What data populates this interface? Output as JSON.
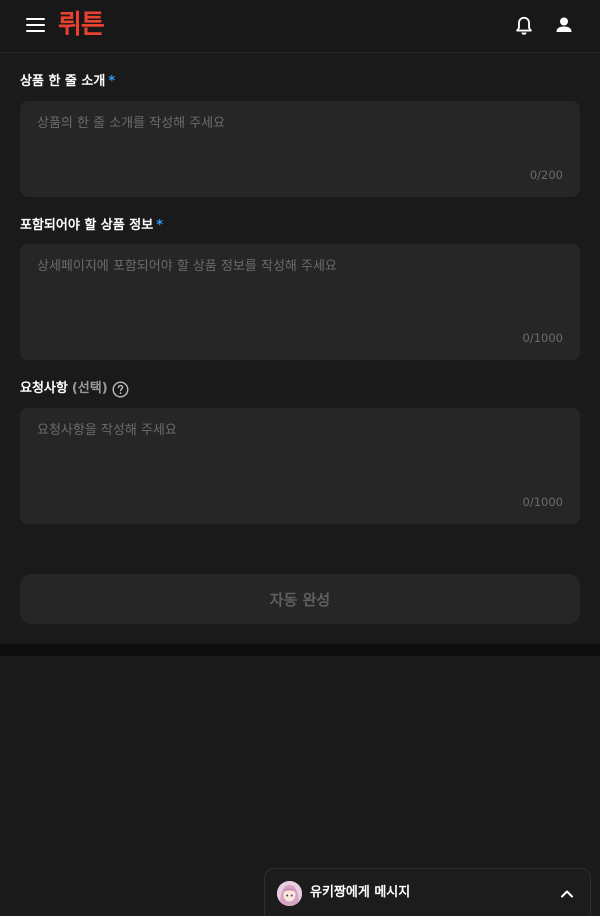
{
  "header": {
    "logo_text": "뤼튼",
    "menu_icon": "hamburger-menu-icon",
    "notification_icon": "bell-icon",
    "profile_icon": "user-icon",
    "brand_color": "#e8412f"
  },
  "form": {
    "intro": {
      "label": "상품 한 줄 소개",
      "required_mark": "*",
      "placeholder": "상품의 한 줄 소개를 작성해 주세요",
      "counter": "0/200"
    },
    "product_info": {
      "label": "포함되어야 할 상품 정보",
      "required_mark": "*",
      "placeholder": "상세페이지에 포함되어야 할 상품 정보를 작성해 주세요",
      "counter": "0/1000"
    },
    "request": {
      "label": "요청사항",
      "optional_text": "(선택)",
      "help_icon": "question-circle-icon",
      "placeholder": "요청사항을 작성해 주세요",
      "counter": "0/1000"
    },
    "submit_label": "자동 완성",
    "required_color": "#2d9cff"
  },
  "chat": {
    "title": "유키짱에게 메시지",
    "avatar": "character-avatar",
    "chevron_icon": "chevron-up-icon"
  }
}
